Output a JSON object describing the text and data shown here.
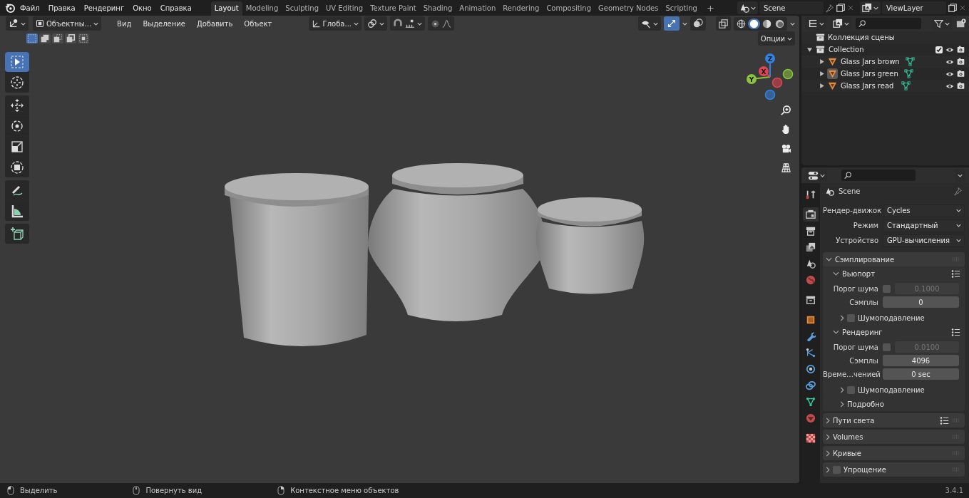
{
  "menu": [
    "Файл",
    "Правка",
    "Рендеринг",
    "Окно",
    "Справка"
  ],
  "workspaces": [
    {
      "label": "Layout",
      "selected": true
    },
    {
      "label": "Modeling",
      "selected": false
    },
    {
      "label": "Sculpting",
      "selected": false
    },
    {
      "label": "UV Editing",
      "selected": false
    },
    {
      "label": "Texture Paint",
      "selected": false
    },
    {
      "label": "Shading",
      "selected": false
    },
    {
      "label": "Animation",
      "selected": false
    },
    {
      "label": "Rendering",
      "selected": false
    },
    {
      "label": "Compositing",
      "selected": false
    },
    {
      "label": "Geometry Nodes",
      "selected": false
    },
    {
      "label": "Scripting",
      "selected": false
    }
  ],
  "add_workspace": "+",
  "scene": "Scene",
  "view_layer": "ViewLayer",
  "viewport": {
    "mode": "Объектны...",
    "menus": [
      "Вид",
      "Выделение",
      "Добавить",
      "Объект"
    ],
    "orientation": "Глоба...",
    "options": "Опции",
    "select_modes": [
      {
        "selected": true
      },
      {
        "selected": false
      },
      {
        "selected": false
      },
      {
        "selected": false
      },
      {
        "selected": false
      }
    ],
    "gizmos_on": true,
    "shading": [
      {
        "kind": "wireframe",
        "selected": false
      },
      {
        "kind": "solid",
        "selected": true
      },
      {
        "kind": "material",
        "selected": false
      },
      {
        "kind": "rendered",
        "selected": false
      }
    ],
    "tool_groups": [
      [
        {
          "kind": "select",
          "selected": true
        },
        {
          "kind": "cursor",
          "selected": false
        }
      ],
      [
        {
          "kind": "move",
          "selected": false
        },
        {
          "kind": "rotate",
          "selected": false
        },
        {
          "kind": "scale",
          "selected": false
        },
        {
          "kind": "transform",
          "selected": false
        }
      ],
      [
        {
          "kind": "annotate",
          "selected": false
        },
        {
          "kind": "measure",
          "selected": false
        }
      ],
      [
        {
          "kind": "add-cube",
          "selected": false
        }
      ]
    ],
    "axes": [
      {
        "label": "Z",
        "color": "#2f83e3"
      },
      {
        "label": "Y",
        "color": "#8bc43c"
      },
      {
        "label": "X",
        "color": "#e04553"
      }
    ]
  },
  "outliner": {
    "title": "Коллекция сцены",
    "children": [
      {
        "name": "Collection",
        "expanded": true,
        "checked": true,
        "children": [
          {
            "name": "Glass Jars brown",
            "expanded": false,
            "selected": false
          },
          {
            "name": "Glass Jars green",
            "expanded": false,
            "selected": true
          },
          {
            "name": "Glass Jars read",
            "expanded": false,
            "selected": false
          }
        ]
      }
    ]
  },
  "properties": {
    "tab_groups": [
      [
        {
          "kind": "tool",
          "selected": false
        }
      ],
      [
        {
          "kind": "render",
          "selected": true
        },
        {
          "kind": "output",
          "selected": false
        },
        {
          "kind": "view-layer",
          "selected": false
        },
        {
          "kind": "scene",
          "selected": false
        },
        {
          "kind": "world",
          "selected": false
        }
      ],
      [
        {
          "kind": "collection",
          "selected": false
        }
      ],
      [
        {
          "kind": "object",
          "selected": false
        },
        {
          "kind": "modifiers",
          "selected": false
        },
        {
          "kind": "particles",
          "selected": false
        },
        {
          "kind": "physics",
          "selected": false
        },
        {
          "kind": "constraints",
          "selected": false
        },
        {
          "kind": "data",
          "selected": false
        },
        {
          "kind": "material",
          "selected": false
        }
      ],
      [
        {
          "kind": "texture",
          "selected": false
        }
      ]
    ],
    "context": "Scene",
    "fields": [
      {
        "label": "Рендер-движок",
        "value": "Cycles"
      },
      {
        "label": "Режим",
        "value": "Стандартный"
      },
      {
        "label": "Устройство",
        "value": "GPU-вычисления"
      }
    ],
    "panels": [
      {
        "title": "Сэмплирование",
        "expanded": true,
        "presets": false,
        "children": [
          {
            "title": "Вьюпорт",
            "expanded": true,
            "presets": true,
            "rows": [
              {
                "kind": "check-number",
                "label": "Порог шума",
                "checked": false,
                "value": "0.1000"
              },
              {
                "kind": "number",
                "label": "Сэмплы",
                "value": "0"
              }
            ],
            "children": [
              {
                "title": "Шумоподавление",
                "expanded": false,
                "presets": false,
                "checked": false
              }
            ]
          },
          {
            "title": "Рендеринг",
            "expanded": true,
            "presets": true,
            "rows": [
              {
                "kind": "check-number",
                "label": "Порог шума",
                "checked": false,
                "value": "0.0100"
              },
              {
                "kind": "number",
                "label": "Сэмплы",
                "value": "4096"
              },
              {
                "kind": "number",
                "label": "Време…ченией",
                "value": "0 sec"
              }
            ],
            "children": [
              {
                "title": "Шумоподавление",
                "expanded": false,
                "presets": false,
                "checked": false
              },
              {
                "title": "Подробно",
                "expanded": false,
                "presets": false
              }
            ]
          }
        ]
      },
      {
        "title": "Пути света",
        "expanded": false,
        "presets": true
      },
      {
        "title": "Volumes",
        "expanded": false,
        "presets": false
      },
      {
        "title": "Кривые",
        "expanded": false,
        "presets": false
      },
      {
        "title": "Упрощение",
        "expanded": false,
        "presets": false,
        "checked": false
      }
    ]
  },
  "status": {
    "hints": [
      {
        "kind": "left-click",
        "label": "Выделить"
      },
      {
        "kind": "middle-click",
        "label": "Повернуть вид"
      },
      {
        "kind": "right-click",
        "label": "Контекстное меню объектов"
      }
    ],
    "version": "3.4.1"
  }
}
